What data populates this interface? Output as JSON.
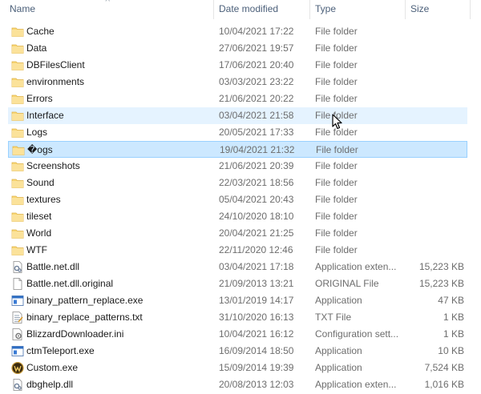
{
  "header": {
    "name": "Name",
    "date_modified": "Date modified",
    "type": "Type",
    "size": "Size"
  },
  "rows": [
    {
      "name": "Cache",
      "date": "10/04/2021 17:22",
      "type": "File folder",
      "size": "",
      "icon": "folder-icon",
      "state": ""
    },
    {
      "name": "Data",
      "date": "27/06/2021 19:57",
      "type": "File folder",
      "size": "",
      "icon": "folder-icon",
      "state": ""
    },
    {
      "name": "DBFilesClient",
      "date": "17/06/2021 20:40",
      "type": "File folder",
      "size": "",
      "icon": "folder-icon",
      "state": ""
    },
    {
      "name": "environments",
      "date": "03/03/2021 23:22",
      "type": "File folder",
      "size": "",
      "icon": "folder-icon",
      "state": ""
    },
    {
      "name": "Errors",
      "date": "21/06/2021 20:22",
      "type": "File folder",
      "size": "",
      "icon": "folder-icon",
      "state": ""
    },
    {
      "name": "Interface",
      "date": "03/04/2021 21:58",
      "type": "File folder",
      "size": "",
      "icon": "folder-icon",
      "state": "hover"
    },
    {
      "name": "Logs",
      "date": "20/05/2021 17:33",
      "type": "File folder",
      "size": "",
      "icon": "folder-icon",
      "state": ""
    },
    {
      "name": "�ogs",
      "date": "19/04/2021 21:32",
      "type": "File folder",
      "size": "",
      "icon": "folder-icon",
      "state": "selected"
    },
    {
      "name": "Screenshots",
      "date": "21/06/2021 20:39",
      "type": "File folder",
      "size": "",
      "icon": "folder-icon",
      "state": ""
    },
    {
      "name": "Sound",
      "date": "22/03/2021 18:56",
      "type": "File folder",
      "size": "",
      "icon": "folder-icon",
      "state": ""
    },
    {
      "name": "textures",
      "date": "05/04/2021 20:43",
      "type": "File folder",
      "size": "",
      "icon": "folder-icon",
      "state": ""
    },
    {
      "name": "tileset",
      "date": "24/10/2020 18:10",
      "type": "File folder",
      "size": "",
      "icon": "folder-icon",
      "state": ""
    },
    {
      "name": "World",
      "date": "20/04/2021 21:25",
      "type": "File folder",
      "size": "",
      "icon": "folder-icon",
      "state": ""
    },
    {
      "name": "WTF",
      "date": "22/11/2020 12:46",
      "type": "File folder",
      "size": "",
      "icon": "folder-icon",
      "state": ""
    },
    {
      "name": "Battle.net.dll",
      "date": "03/04/2021 17:18",
      "type": "Application exten...",
      "size": "15,223 KB",
      "icon": "dll-file-icon",
      "state": ""
    },
    {
      "name": "Battle.net.dll.original",
      "date": "21/09/2013 13:21",
      "type": "ORIGINAL File",
      "size": "15,223 KB",
      "icon": "blank-file-icon",
      "state": ""
    },
    {
      "name": "binary_pattern_replace.exe",
      "date": "13/01/2019 14:17",
      "type": "Application",
      "size": "47 KB",
      "icon": "exe-file-icon",
      "state": ""
    },
    {
      "name": "binary_replace_patterns.txt",
      "date": "31/10/2020 16:13",
      "type": "TXT File",
      "size": "1 KB",
      "icon": "text-file-icon",
      "state": ""
    },
    {
      "name": "BlizzardDownloader.ini",
      "date": "10/04/2021 16:12",
      "type": "Configuration sett...",
      "size": "1 KB",
      "icon": "ini-file-icon",
      "state": ""
    },
    {
      "name": "ctmTeleport.exe",
      "date": "16/09/2014 18:50",
      "type": "Application",
      "size": "10 KB",
      "icon": "exe-file-icon",
      "state": ""
    },
    {
      "name": "Custom.exe",
      "date": "15/09/2014 19:39",
      "type": "Application",
      "size": "7,524 KB",
      "icon": "wow-logo-icon",
      "state": ""
    },
    {
      "name": "dbghelp.dll",
      "date": "20/08/2013 12:03",
      "type": "Application exten...",
      "size": "1,016 KB",
      "icon": "dll-file-icon",
      "state": ""
    }
  ],
  "colors": {
    "folder": "#f8d775",
    "folder_dark": "#e0b34a",
    "hover": "#e5f3ff",
    "selected": "#cce8ff",
    "selected_border": "#99d1ff",
    "header_text": "#4c607a",
    "secondary_text": "#6d6d6d"
  }
}
